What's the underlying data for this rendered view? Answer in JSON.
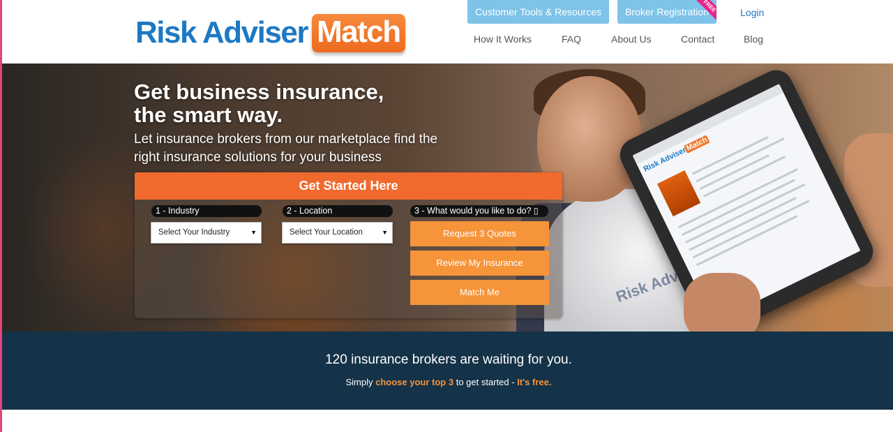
{
  "header": {
    "logo": {
      "part1": "Risk Adviser",
      "part2": "Match"
    },
    "top_buttons": {
      "tools": "Customer Tools & Resources",
      "broker": "Broker Registration",
      "free_badge": "FREE"
    },
    "login": "Login",
    "nav": [
      "How It Works",
      "FAQ",
      "About Us",
      "Contact",
      "Blog"
    ]
  },
  "hero": {
    "title_line1": "Get business insurance,",
    "title_line2": "the smart way.",
    "subtitle_line1": "Let insurance brokers from our marketplace find the",
    "subtitle_line2": "right insurance solutions for your business",
    "shirt_text": "Risk Adviser",
    "tablet_logo_part1": "Risk Adviser",
    "tablet_logo_part2": "Match"
  },
  "form": {
    "header": "Get Started Here",
    "step1_label": "1 - Industry",
    "step2_label": "2 - Location",
    "step3_label": "3 - What would you like to do? ▯",
    "industry_select": "Select Your Industry",
    "location_select": "Select Your Location",
    "actions": [
      "Request 3 Quotes",
      "Review My Insurance",
      "Match Me"
    ]
  },
  "banner": {
    "main": "120 insurance brokers are waiting for you.",
    "sub_prefix": "Simply ",
    "sub_highlight1": "choose your top 3",
    "sub_middle": " to get started - ",
    "sub_highlight2": "It's free."
  },
  "colors": {
    "brand_blue": "#1d79c4",
    "brand_orange": "#f06a2e",
    "button_orange": "#f6943a",
    "banner_bg": "#143248",
    "light_blue_button": "#7ec3e8"
  }
}
